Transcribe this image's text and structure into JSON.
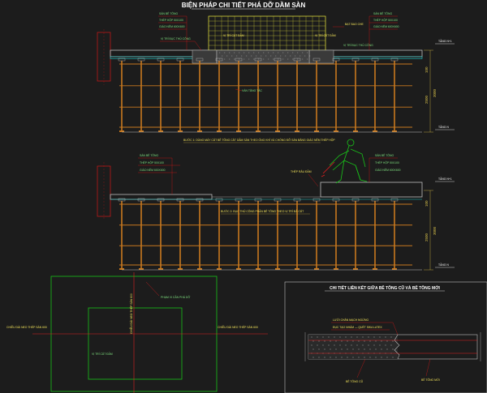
{
  "title": "BIỆN PHÁP CHI TIẾT PHÁ DỠ DẦM SÀN",
  "top_section": {
    "left_callouts": [
      "SÀN BÊ TÔNG",
      "THÉP HỘP 50X100",
      "GIÁO NÊM 600X600",
      "VỊ TRÍ ĐỤC THỦ CÔNG"
    ],
    "right_callouts": [
      "SÀN BÊ TÔNG",
      "THÉP HỘP 50X100",
      "GIÁO NÊM 600X600",
      "VỊ TRÍ ĐỤC THỦ CÔNG"
    ],
    "cut_label_left": "VỊ TRÍ CẮT ĐẦM",
    "cut_label_right": "VỊ TRÍ CẮT ĐẦM",
    "cover_label": "BẠT BAO CHE",
    "sole_plate_label": "VÁN TĂNG TẢC",
    "level_top": "TẦNG N+1",
    "level_bottom": "TẦNG N",
    "dim_small": "100",
    "dim_total": "3000",
    "dim_height": "2500",
    "step_caption": "BƯỚC 1: DÙNG MÁY CẮT BÊ TÔNG CẮT DẦM SÀN THEO ỐNG KHÍ VÀ CHỐNG ĐỠ SÀN BẰNG GIÁO NÊM THÉP HỘP"
  },
  "middle_section": {
    "left_callouts": [
      "SÀN BÊ TÔNG",
      "THÉP HỘP 50X100",
      "GIÁO NÊM 600X600"
    ],
    "right_callouts": [
      "SÀN BÊ TÔNG",
      "THÉP HỘP 50X100",
      "GIÁO NÊM 600X600"
    ],
    "rebar_label": "THÉP RÂU ĐẦM",
    "level_top": "TẦNG N+1",
    "level_bottom": "TẦNG N",
    "dim_small": "100",
    "dim_total": "3000",
    "dim_height": "2500",
    "step_caption": "BƯỚC 2: ĐỤC THỦ CÔNG PHẦN BÊ TÔNG THEO VỊ TRÍ ĐÃ CẮT"
  },
  "plan_section": {
    "demolish_label": "PHẠM VI CẦN PHÁ DỠ",
    "cut_position_label": "VỊ TRÍ CẮT ĐẦM",
    "left_label": "CHIỀU DÀI NEO THÉP SÀN 600",
    "right_label": "CHIỀU DÀI NEO THÉP SÀN 600",
    "vertical_label": "CHIỀU DÀI NEO THÉP SÀN 600"
  },
  "joint_detail": {
    "title": "CHI TIẾT LIÊN KẾT GIỮA BÊ TÔNG CŨ VÀ BÊ TÔNG MỚI",
    "label_1": "LƯỚI CHẮN MẠCH NGỪNG",
    "label_2": "ĐỤC TẠO NHÁM — QUÉT SIKA LATEX",
    "old_concrete": "BÊ TÔNG CŨ",
    "new_concrete": "BÊ TÔNG MỚI"
  },
  "colors": {
    "background": "#1c1c1c",
    "scaffold": "#c8781e",
    "slab": "#bfbfbf",
    "dim": "#d9c24a",
    "leader_red": "#e02020",
    "mesh": "#d6d23a",
    "callout_text": "#7fe07f",
    "plan_green": "#19c219"
  }
}
